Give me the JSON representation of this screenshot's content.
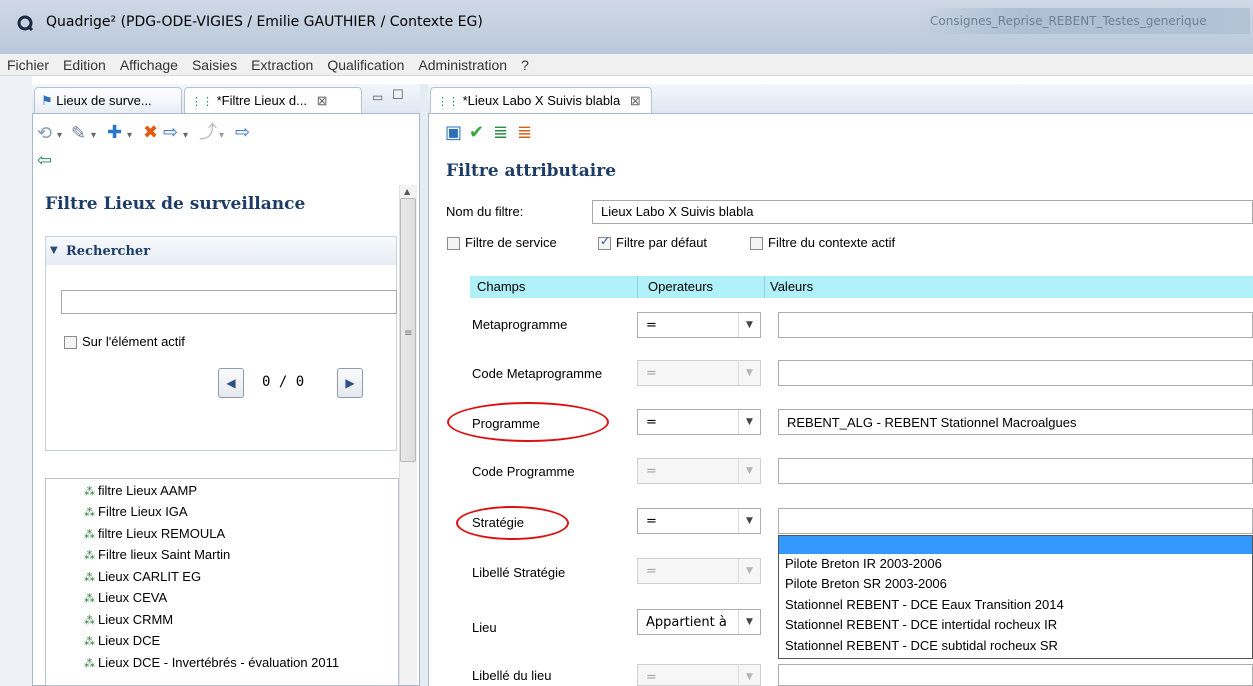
{
  "window": {
    "title": "Quadrige² (PDG-ODE-VIGIES / Emilie GAUTHIER / Contexte EG)",
    "right_text": "Consignes_Reprise_REBENT_Testes_generique"
  },
  "menu": [
    "Fichier",
    "Edition",
    "Affichage",
    "Saisies",
    "Extraction",
    "Qualification",
    "Administration",
    "?"
  ],
  "left_tabs": [
    {
      "label": "Lieux de surve..."
    },
    {
      "label": "*Filtre Lieux d..."
    }
  ],
  "left_panel": {
    "title": "Filtre Lieux de surveillance",
    "search_header": "Rechercher",
    "search_value": "",
    "active_element_label": "Sur l'élément actif",
    "pager": "0  /  0"
  },
  "tree_items": [
    "filtre Lieux AAMP",
    "Filtre Lieux IGA",
    "filtre Lieux REMOULA",
    "Filtre lieux Saint Martin",
    "Lieux CARLIT EG",
    "Lieux CEVA",
    "Lieux CRMM",
    "Lieux DCE",
    "Lieux DCE - Invertébrés - évaluation 2011"
  ],
  "right_tab": {
    "label": "*Lieux Labo X Suivis blabla"
  },
  "form": {
    "title": "Filtre attributaire",
    "name_label": "Nom du filtre:",
    "name_value": "Lieux Labo X Suivis blabla",
    "checks": [
      {
        "label": "Filtre de service",
        "checked": false
      },
      {
        "label": "Filtre par défaut",
        "checked": true
      },
      {
        "label": "Filtre du contexte actif",
        "checked": false
      }
    ],
    "grid_headers": [
      "Champs",
      "Operateurs",
      "Valeurs"
    ],
    "rows": [
      {
        "field": "Metaprogramme",
        "operator": "=",
        "value": ""
      },
      {
        "field": "Code Metaprogramme",
        "operator": "=",
        "value": ""
      },
      {
        "field": "Programme",
        "operator": "=",
        "value": "REBENT_ALG - REBENT Stationnel Macroalgues"
      },
      {
        "field": "Code Programme",
        "operator": "=",
        "value": ""
      },
      {
        "field": "Stratégie",
        "operator": "=",
        "value": ""
      },
      {
        "field": "Libellé Stratégie",
        "operator": "=",
        "value": ""
      },
      {
        "field": "Lieu",
        "operator": "Appartient à",
        "value": ""
      },
      {
        "field": "Libellé du lieu",
        "operator": "=",
        "value": ""
      }
    ],
    "dropdown_options": [
      "",
      "Pilote Breton IR 2003-2006",
      "Pilote Breton SR 2003-2006",
      "Stationnel REBENT - DCE Eaux Transition 2014",
      "Stationnel REBENT - DCE intertidal rocheux IR",
      "Stationnel REBENT - DCE subtidal rocheux SR"
    ]
  }
}
